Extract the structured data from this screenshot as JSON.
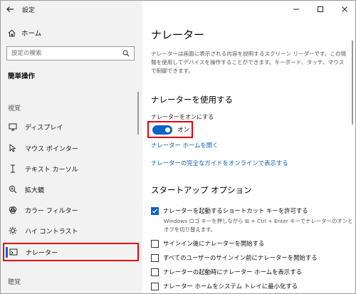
{
  "window": {
    "title": "設定"
  },
  "sidebar": {
    "home_label": "ホーム",
    "search_placeholder": "設定の検索",
    "section_title": "簡単操作",
    "group_vision": "視覚",
    "group_hearing": "聴覚",
    "items": [
      {
        "label": "ディスプレイ",
        "icon": "display-icon"
      },
      {
        "label": "マウス ポインター",
        "icon": "mouse-pointer-icon"
      },
      {
        "label": "テキスト カーソル",
        "icon": "text-cursor-icon"
      },
      {
        "label": "拡大鏡",
        "icon": "magnifier-icon"
      },
      {
        "label": "カラー フィルター",
        "icon": "color-filter-icon"
      },
      {
        "label": "ハイ コントラスト",
        "icon": "high-contrast-icon"
      },
      {
        "label": "ナレーター",
        "icon": "narrator-icon",
        "selected": true
      }
    ]
  },
  "main": {
    "title": "ナレーター",
    "description": "ナレーターは画面に表示される内容を説明するスクリーン リーダーです。この情報を使用してデバイスを操作することができます。キーボード、タッチ、マウスで制御できます。",
    "use_heading": "ナレーターを使用する",
    "toggle_label": "ナレーターをオンにする",
    "toggle_state": "オン",
    "toggle_on": true,
    "link_home": "ナレーター ホームを開く",
    "link_guide": "ナレーターの完全なガイドをオンラインで表示する",
    "startup_heading": "スタートアップ オプション",
    "shortcut_label": "ナレーターを起動するショートカット キーを許可する",
    "shortcut_checked": true,
    "shortcut_note": "Windows ロゴ キーを押しながら ⊞ + Ctrl + Enter キーでナレーターのオンとオフを切り替えます。",
    "options": [
      {
        "label": "サインイン後にナレーターを開始する",
        "checked": false
      },
      {
        "label": "すべてのユーザーのサインイン前にナレーターを開始する",
        "checked": false
      },
      {
        "label": "ナレーターの起動時にナレーター ホームを表示する",
        "checked": false
      },
      {
        "label": "ナレーター ホームをシステム トレイに最小化する",
        "checked": false
      }
    ]
  },
  "colors": {
    "accent": "#0a64c8",
    "highlight": "#e60012",
    "link": "#0a5fb4"
  }
}
